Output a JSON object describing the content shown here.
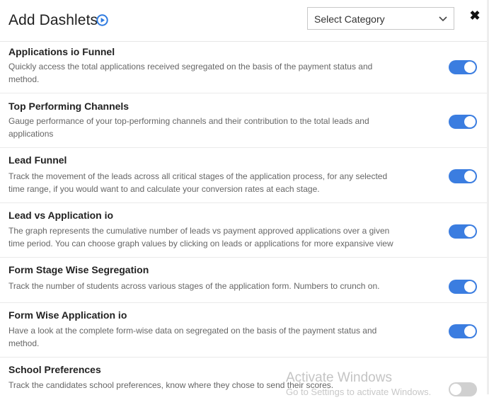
{
  "header": {
    "title": "Add Dashlets",
    "category_select": {
      "selected": "Select Category"
    },
    "close_glyph": "✖"
  },
  "colors": {
    "toggle_on": "#3b7de0",
    "toggle_off": "#d0d0d0",
    "accent": "#2f7be0"
  },
  "dashlets": [
    {
      "title": "Applications io Funnel",
      "description_line1": "Quickly access the total applications received segregated on the basis of the payment status and",
      "description_line2": "method.",
      "enabled": true
    },
    {
      "title": "Top Performing Channels",
      "description_line1": "Gauge performance of your top-performing channels and their contribution to the total leads and",
      "description_line2": "applications",
      "enabled": true
    },
    {
      "title": "Lead Funnel",
      "description_line1": "Track the movement of the leads across all critical stages of the application process, for any selected",
      "description_line2": "time range, if you would want to and calculate your conversion rates at each stage.",
      "enabled": true
    },
    {
      "title": "Lead vs Application io",
      "description_line1": "The graph represents the cumulative number of leads vs payment approved applications over a given",
      "description_line2": "time period. You can choose graph values by clicking on leads or applications for more expansive view",
      "enabled": true
    },
    {
      "title": "Form Stage Wise Segregation",
      "description_line1": "Track the number of students across various stages of the application form. Numbers to crunch on.",
      "description_line2": "",
      "enabled": true
    },
    {
      "title": "Form Wise Application io",
      "description_line1": "Have a look at the complete form-wise data on segregated on the basis of the payment status and",
      "description_line2": "method.",
      "enabled": true
    },
    {
      "title": "School Preferences",
      "description_line1": "Track the candidates school preferences, know where they chose to send their scores.",
      "description_line2": "",
      "enabled": false
    }
  ],
  "watermark": {
    "line1": "Activate Windows",
    "line2": "Go to Settings to activate Windows."
  }
}
